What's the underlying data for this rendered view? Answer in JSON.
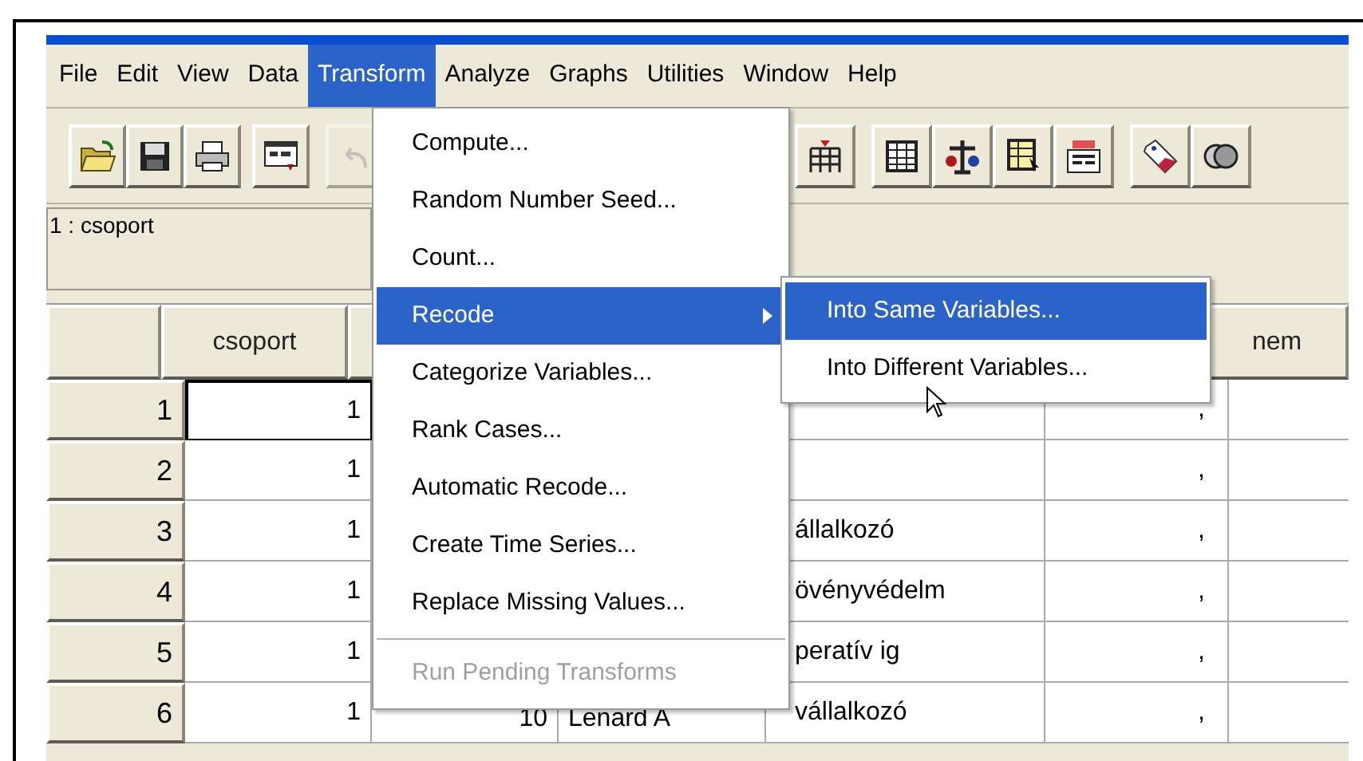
{
  "menubar": [
    {
      "label": "File",
      "selected": false
    },
    {
      "label": "Edit",
      "selected": false
    },
    {
      "label": "View",
      "selected": false
    },
    {
      "label": "Data",
      "selected": false
    },
    {
      "label": "Transform",
      "selected": true
    },
    {
      "label": "Analyze",
      "selected": false
    },
    {
      "label": "Graphs",
      "selected": false
    },
    {
      "label": "Utilities",
      "selected": false
    },
    {
      "label": "Window",
      "selected": false
    },
    {
      "label": "Help",
      "selected": false
    }
  ],
  "toolbar": [
    {
      "kind": "open",
      "disabled": false
    },
    {
      "kind": "save",
      "disabled": false
    },
    {
      "kind": "print",
      "disabled": false
    },
    {
      "kind": "dialog",
      "disabled": false
    },
    {
      "kind": "undo",
      "disabled": true
    },
    {
      "kind": "goto",
      "disabled": false
    },
    {
      "kind": "insert",
      "disabled": false
    },
    {
      "kind": "split",
      "disabled": false
    },
    {
      "kind": "select",
      "disabled": false
    },
    {
      "kind": "labels",
      "disabled": false
    },
    {
      "kind": "sets",
      "disabled": false
    },
    {
      "kind": "circles",
      "disabled": false
    }
  ],
  "cell_editor": {
    "label": "1 : csoport"
  },
  "grid": {
    "column_headers": {
      "csoport": "csoport",
      "column_7": "nem"
    },
    "rows": [
      {
        "number": "1",
        "csoport": "1",
        "column_6": ","
      },
      {
        "number": "2",
        "csoport": "1",
        "column_6": ","
      },
      {
        "number": "3",
        "csoport": "1",
        "column_5": "állalkozó",
        "column_6": ","
      },
      {
        "number": "4",
        "csoport": "1",
        "column_5": "övényvédelm",
        "column_6": ","
      },
      {
        "number": "5",
        "csoport": "1",
        "column_5": "peratív ig",
        "column_6": ","
      },
      {
        "number": "6",
        "csoport": "1",
        "column_3": "10",
        "column_4": "Lenard A",
        "column_5": "vállalkozó",
        "column_6": ","
      }
    ]
  },
  "transform_menu": [
    {
      "kind": "item",
      "label": "Compute...",
      "selected": false,
      "disabled": false
    },
    {
      "kind": "item",
      "label": "Random Number Seed...",
      "selected": false,
      "disabled": false
    },
    {
      "kind": "item",
      "label": "Count...",
      "selected": false,
      "disabled": false
    },
    {
      "kind": "submenu",
      "label": "Recode",
      "selected": true,
      "disabled": false
    },
    {
      "kind": "item",
      "label": "Categorize Variables...",
      "selected": false,
      "disabled": false
    },
    {
      "kind": "item",
      "label": "Rank Cases...",
      "selected": false,
      "disabled": false
    },
    {
      "kind": "item",
      "label": "Automatic Recode...",
      "selected": false,
      "disabled": false
    },
    {
      "kind": "item",
      "label": "Create Time Series...",
      "selected": false,
      "disabled": false
    },
    {
      "kind": "item",
      "label": "Replace Missing Values...",
      "selected": false,
      "disabled": false
    },
    {
      "kind": "separator"
    },
    {
      "kind": "item",
      "label": "Run Pending Transforms",
      "selected": false,
      "disabled": true
    }
  ],
  "recode_submenu": [
    {
      "label": "Into Same Variables...",
      "selected": true
    },
    {
      "label": "Into Different Variables...",
      "selected": false
    }
  ]
}
